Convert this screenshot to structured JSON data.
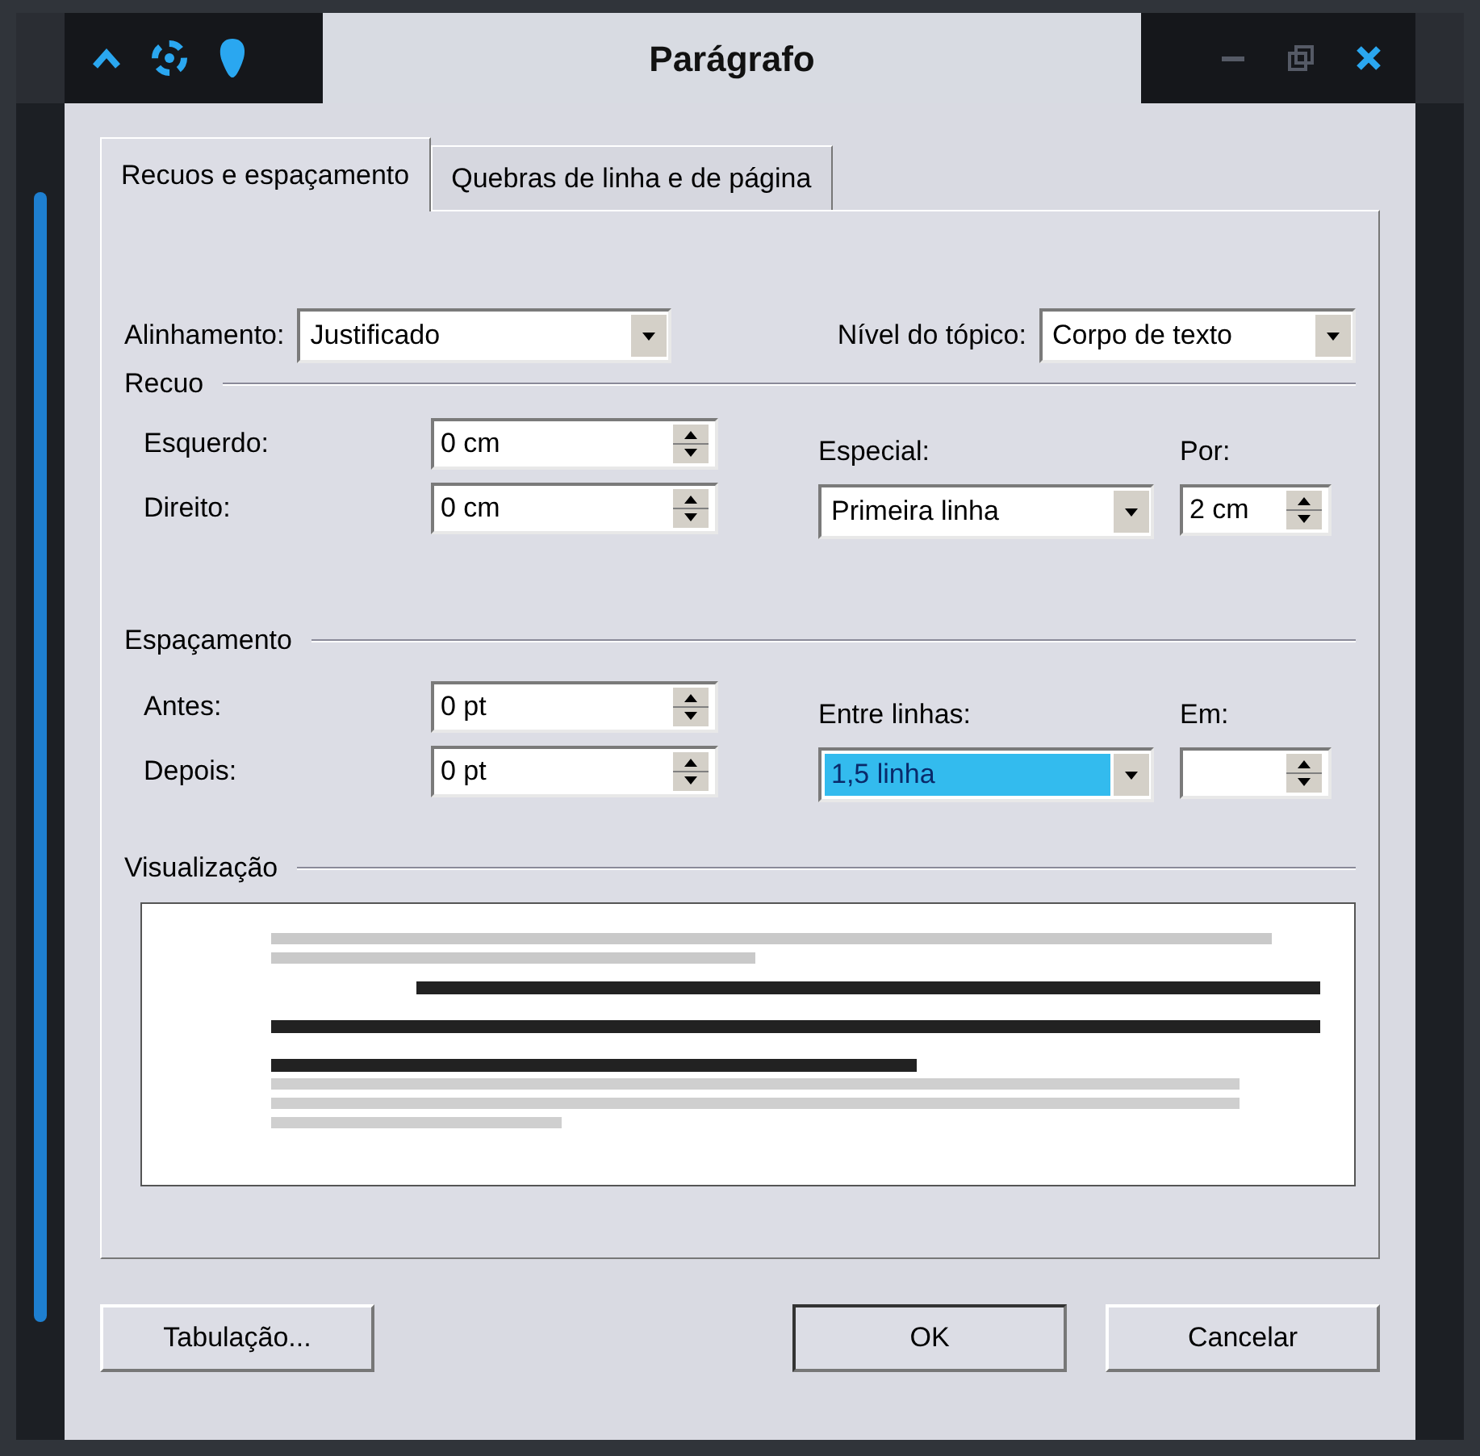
{
  "window": {
    "title": "Parágrafo"
  },
  "tabs": [
    {
      "label": "Recuos e espaçamento",
      "selected": true
    },
    {
      "label": "Quebras de linha e de página",
      "selected": false
    }
  ],
  "alignment": {
    "label": "Alinhamento:",
    "value": "Justificado"
  },
  "outline_level": {
    "label": "Nível do tópico:",
    "value": "Corpo de texto"
  },
  "indent": {
    "title": "Recuo",
    "left": {
      "label": "Esquerdo:",
      "value": "0 cm"
    },
    "right": {
      "label": "Direito:",
      "value": "0 cm"
    },
    "special": {
      "label": "Especial:",
      "value": "Primeira linha"
    },
    "by": {
      "label": "Por:",
      "value": "2 cm"
    }
  },
  "spacing": {
    "title": "Espaçamento",
    "before": {
      "label": "Antes:",
      "value": "0 pt"
    },
    "after": {
      "label": "Depois:",
      "value": "0 pt"
    },
    "line_spacing": {
      "label": "Entre linhas:",
      "value": "1,5 linha",
      "focused": true
    },
    "at": {
      "label": "Em:"
    }
  },
  "preview": {
    "title": "Visualização"
  },
  "buttons": [
    {
      "label": "Tabulação...",
      "kind": "tabs"
    },
    {
      "label": "OK",
      "kind": "ok"
    },
    {
      "label": "Cancelar",
      "kind": "cancel"
    }
  ]
}
